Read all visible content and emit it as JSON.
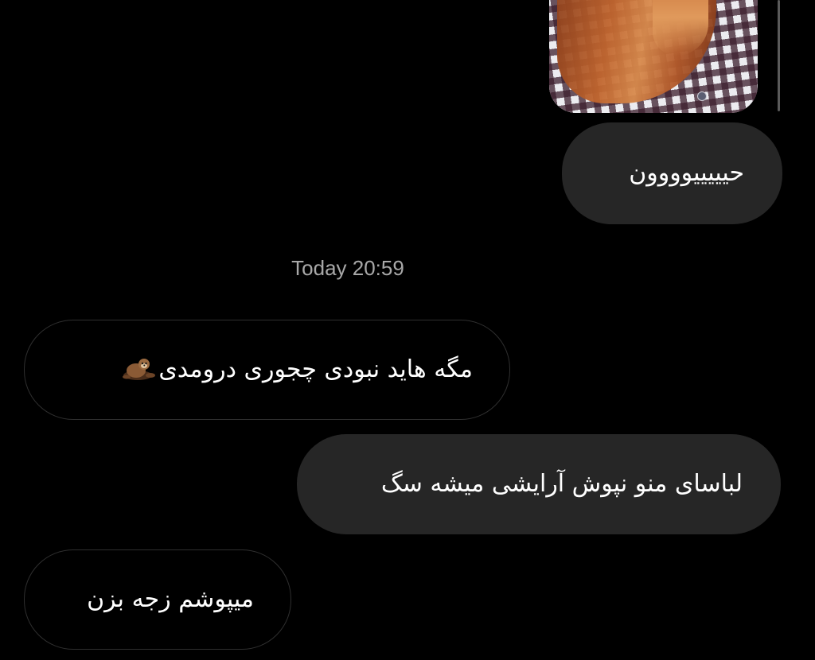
{
  "conversation": {
    "messages": [
      {
        "direction": "outgoing",
        "text": "حیییییوووون"
      },
      {
        "direction": "incoming",
        "text": "مگه هاید نبودی چجوری درومدی",
        "emoji": "otter"
      },
      {
        "direction": "outgoing",
        "text": "لباسای منو نپوش آرایشی میشه سگ"
      },
      {
        "direction": "incoming",
        "text": "میپوشم زجه بزن"
      }
    ],
    "timestamp": "Today 20:59"
  },
  "icons": {
    "emoji_otter": "otter-emoji-icon"
  },
  "colors": {
    "background": "#000000",
    "outgoing_bubble": "#262626",
    "incoming_border": "#2f2f2f",
    "timestamp_text": "#a8a8a8",
    "message_text": "#ffffff"
  }
}
